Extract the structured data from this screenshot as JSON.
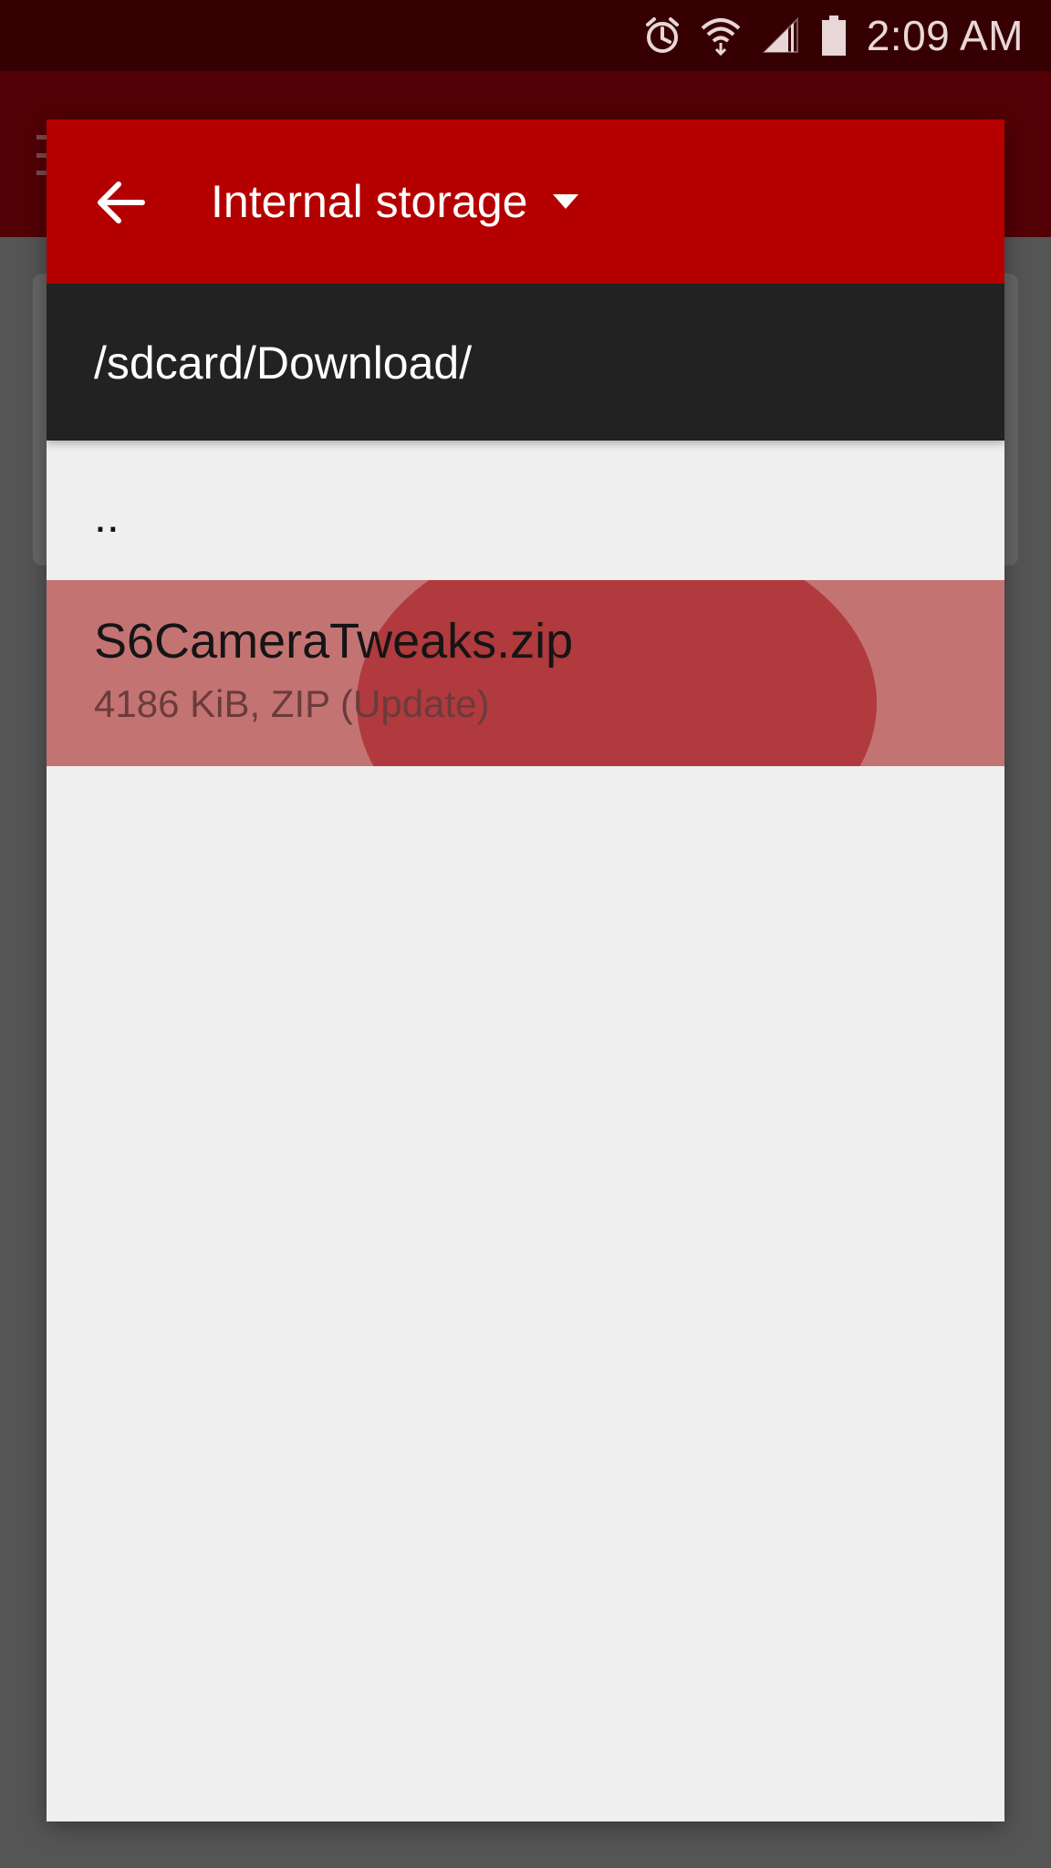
{
  "status_bar": {
    "time": "2:09 AM",
    "icons": [
      "alarm-icon",
      "wifi-icon",
      "cell-signal-icon",
      "battery-icon"
    ]
  },
  "dialog": {
    "storage_label": "Internal storage",
    "path": "/sdcard/Download/",
    "items": [
      {
        "name": ".."
      },
      {
        "name": "S6CameraTweaks.zip",
        "meta": "4186 KiB, ZIP (Update)"
      }
    ]
  },
  "colors": {
    "status_bar_bg": "#360003",
    "header_bg": "#b50000",
    "path_bar_bg": "#222222",
    "list_bg": "#efefef",
    "selected_row_bg": "#c47373",
    "ripple": "#b03a3d"
  }
}
